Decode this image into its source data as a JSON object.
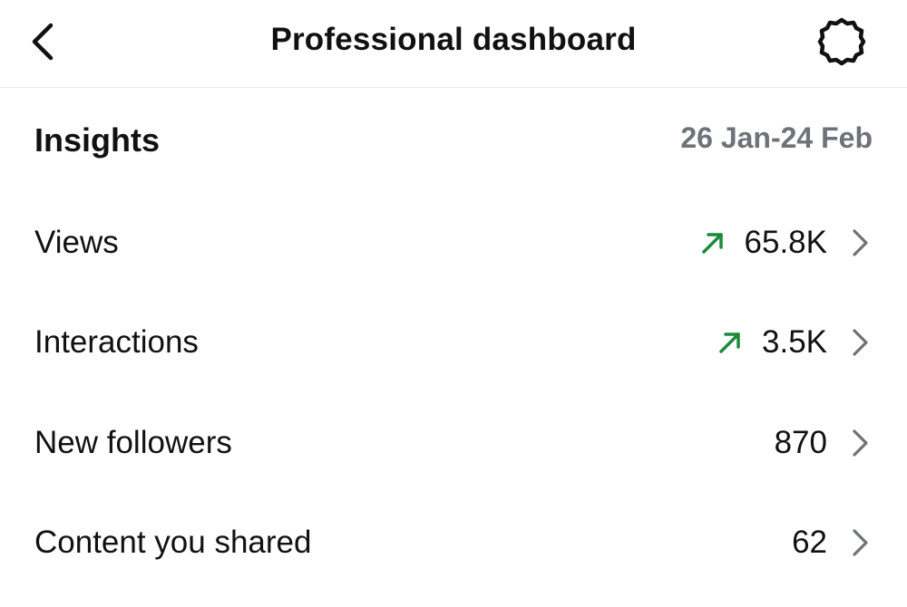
{
  "header": {
    "title": "Professional dashboard",
    "back_icon": "chevron-left-icon",
    "settings_icon": "gear-icon"
  },
  "insights": {
    "title": "Insights",
    "date_range": "26 Jan-24 Feb"
  },
  "metrics": [
    {
      "label": "Views",
      "value": "65.8K",
      "trend": "up"
    },
    {
      "label": "Interactions",
      "value": "3.5K",
      "trend": "up"
    },
    {
      "label": "New followers",
      "value": "870",
      "trend": "none"
    },
    {
      "label": "Content you shared",
      "value": "62",
      "trend": "none"
    }
  ],
  "colors": {
    "trend_up": "#1a8a3a",
    "muted_text": "#6e737a",
    "chevron": "#6e737a"
  }
}
